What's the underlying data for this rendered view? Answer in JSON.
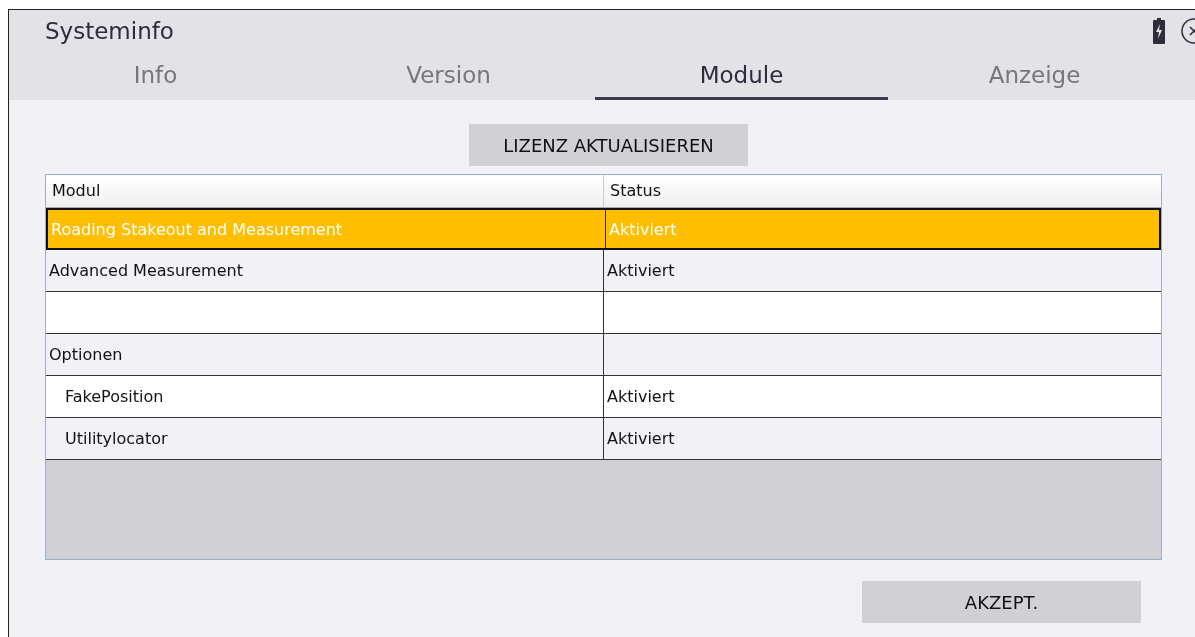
{
  "window": {
    "title": "Systeminfo"
  },
  "tabs": [
    {
      "label": "Info",
      "selected": false
    },
    {
      "label": "Version",
      "selected": false
    },
    {
      "label": "Module",
      "selected": true
    },
    {
      "label": "Anzeige",
      "selected": false
    }
  ],
  "license_button": "LIZENZ AKTUALISIEREN",
  "table": {
    "columns": [
      "Modul",
      "Status"
    ],
    "rows": [
      {
        "module": "Roading Stakeout and Measurement",
        "status": "Aktiviert",
        "selected": true
      },
      {
        "module": "Advanced Measurement",
        "status": "Aktiviert",
        "selected": false
      },
      {
        "selected": false
      },
      {
        "module": "Optionen",
        "selected": false,
        "children": [
          {
            "module": "FakePosition",
            "status": "Aktiviert",
            "selected": false
          },
          {
            "module": "Utilitylocator",
            "status": "Aktiviert",
            "selected": false
          }
        ]
      }
    ]
  },
  "accept_button": "AKZEPT."
}
